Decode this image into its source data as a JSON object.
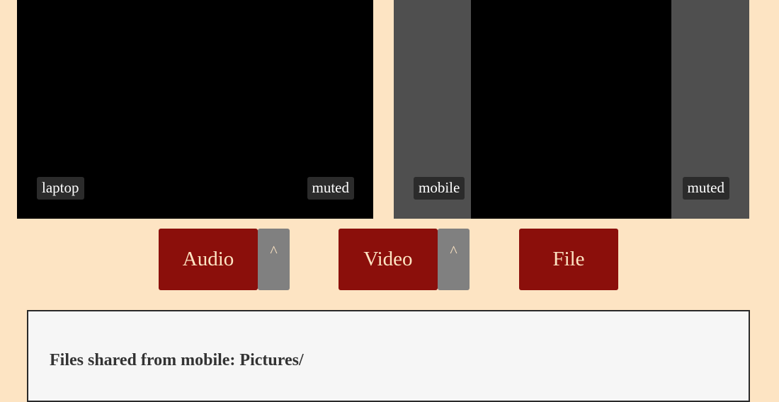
{
  "tiles": [
    {
      "name": "laptop",
      "status": "muted"
    },
    {
      "name": "mobile",
      "status": "muted"
    }
  ],
  "controls": {
    "audio_label": "Audio",
    "audio_menu_label": "^",
    "video_label": "Video",
    "video_menu_label": "^",
    "file_label": "File"
  },
  "files": {
    "title": "Files shared from mobile: Pictures/"
  },
  "colors": {
    "background": "#fde4c3",
    "button": "#8b0f0b",
    "caret_button": "#808080",
    "label_bg": "#2b2b2b",
    "panel_bg": "#f6f6f6"
  }
}
